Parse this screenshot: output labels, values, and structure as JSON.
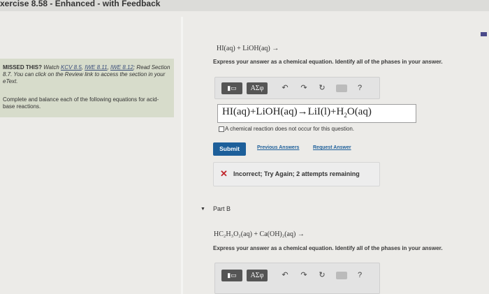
{
  "header": {
    "title": "xercise 8.58 - Enhanced - with Feedback"
  },
  "sidebar": {
    "missed_label": "MISSED THIS?",
    "missed_watch": " Watch ",
    "missed_links": [
      "KCV 8.5",
      "IWE 8.11",
      "IWE 8.12"
    ],
    "missed_rest": "Read Section 8.7. You can click on the Review link to access the section in your eText.",
    "instructions": "Complete and balance each of the following equations for acid-base reactions."
  },
  "part_a": {
    "equation": "HI(aq) + LiOH(aq) →",
    "prompt": "Express your answer as a chemical equation. Identify all of the phases in your answer.",
    "answer": "HI(aq)+LiOH(aq)→LiI(l)+H",
    "answer_sub": "2",
    "answer_tail": "O(aq)",
    "no_reaction_label": "A chemical reaction does not occur for this question.",
    "submit_label": "Submit",
    "previous_answers_label": "Previous Answers",
    "request_answer_label": "Request Answer",
    "feedback_message": "Incorrect; Try Again; 2 attempts remaining"
  },
  "toolbar": {
    "greek_label": "ΑΣφ",
    "help_label": "?"
  },
  "part_b": {
    "label": "Part B",
    "equation": "HC₂H₃O₂(aq) + Ca(OH)₂(aq) →",
    "prompt": "Express your answer as a chemical equation. Identify all of the phases in your answer."
  },
  "colors": {
    "accent": "#1d5f9a",
    "error": "#c0272d",
    "sidebar_bg": "#d7dccb"
  }
}
